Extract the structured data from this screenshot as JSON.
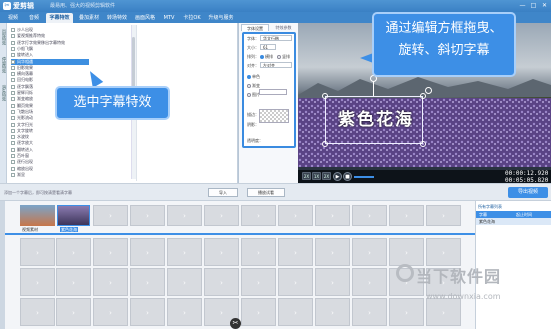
{
  "app": {
    "name": "爱剪辑",
    "slogan": "最易用、强大的视频剪辑软件",
    "window_buttons": [
      "—",
      "□",
      "✕"
    ]
  },
  "tabs": [
    {
      "label": "视频",
      "active": false
    },
    {
      "label": "音频",
      "active": false
    },
    {
      "label": "字幕特效",
      "active": true
    },
    {
      "label": "叠加素材",
      "active": false
    },
    {
      "label": "转场特效",
      "active": false
    },
    {
      "label": "画面风格",
      "active": false
    },
    {
      "label": "MTV",
      "active": false
    },
    {
      "label": "卡拉OK",
      "active": false
    },
    {
      "label": "升级与服务",
      "active": false
    }
  ],
  "side_tabs": [
    "出现特效",
    "停留特效",
    "消失特效"
  ],
  "effects": [
    {
      "label": "沙人出现",
      "selected": false
    },
    {
      "label": "爱视频推荐特效",
      "selected": false
    },
    {
      "label": "逐字打字效果移出字幕特效",
      "selected": false
    },
    {
      "label": "小船飞飘",
      "selected": false
    },
    {
      "label": "旋转进入",
      "selected": false
    },
    {
      "label": "风华相遇",
      "selected": true
    },
    {
      "label": "旧影效果",
      "selected": false
    },
    {
      "label": "横向落幕",
      "selected": false
    },
    {
      "label": "回归电影",
      "selected": false
    },
    {
      "label": "逐字飘落",
      "selected": false
    },
    {
      "label": "星辉闪烁",
      "selected": false
    },
    {
      "label": "渐变缩放",
      "selected": false
    },
    {
      "label": "翻页效果",
      "selected": false
    },
    {
      "label": "飞散出场",
      "selected": false
    },
    {
      "label": "光影流动",
      "selected": false
    },
    {
      "label": "文字扫光",
      "selected": false
    },
    {
      "label": "文字旋转",
      "selected": false
    },
    {
      "label": "水波纹",
      "selected": false
    },
    {
      "label": "逐字放大",
      "selected": false
    },
    {
      "label": "翻转进入",
      "selected": false
    },
    {
      "label": "百叶窗",
      "selected": false
    },
    {
      "label": "逐行出现",
      "selected": false
    },
    {
      "label": "缩放出现",
      "selected": false
    },
    {
      "label": "渐显",
      "selected": false
    }
  ],
  "callouts": {
    "left": "选中字幕特效",
    "right_line1": "通过编辑方框拖曳、",
    "right_line2": "旋转、斜切字幕"
  },
  "settings": {
    "tab1": "字体设置",
    "tab2": "特效参数",
    "font_label": "字体：",
    "font_value": "华文行楷",
    "size_label": "大小：",
    "size_value": "61",
    "layout_label": "排列：",
    "layout_horizontal": "横排",
    "layout_vertical": "竖排",
    "align_label": "对齐：",
    "align_value": "左对齐",
    "single_color": "单色",
    "gradient": "渐变",
    "image": "图片",
    "stroke_label": "描边：",
    "shadow_label": "阴影：",
    "opacity_label": "透明度："
  },
  "subtitle": {
    "text": "紫色花海"
  },
  "player": {
    "time_current": "00:00:12.920",
    "time_total": "00:05:05.820",
    "speed_buttons": [
      "2X",
      "1X",
      "2X"
    ],
    "progress": 0
  },
  "middle": {
    "hint": "添加一个字幕后，即可按清楚看清字幕",
    "button1": "导入",
    "button2": "导出视频",
    "button3": "播放试看",
    "export": "导出视频"
  },
  "timeline": {
    "clip1_label": "视频素材",
    "clip2_label": "紫色花海",
    "clip2_time": "00:00:05"
  },
  "sublist": {
    "title": "所有字幕列表",
    "col1": "字幕",
    "col2": "起止时间",
    "row_text": "紫色花海",
    "row_time": "00:00"
  },
  "watermark": {
    "text": "当下软件园",
    "url": "www.downxia.com"
  },
  "colors": {
    "accent": "#3d8fe6",
    "title_bar": "#3f86c9"
  }
}
